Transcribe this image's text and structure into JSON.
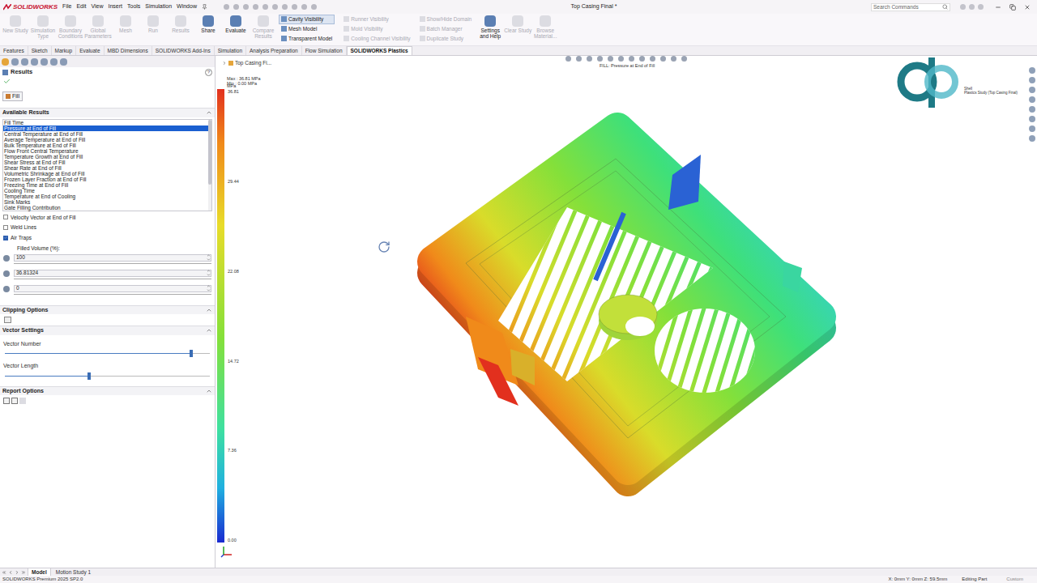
{
  "app": {
    "logo": "SOLIDWORKS",
    "menu": [
      "File",
      "Edit",
      "View",
      "Insert",
      "Tools",
      "Simulation",
      "Window"
    ],
    "title": "Top Casing Final *",
    "search": {
      "placeholder": "Search Commands"
    }
  },
  "ribbon": {
    "large_buttons": [
      {
        "label": "New Study",
        "disabled": true
      },
      {
        "label": "Simulation Type",
        "disabled": true
      },
      {
        "label": "Boundary Conditions",
        "disabled": true
      },
      {
        "label": "Global Parameters",
        "disabled": true
      },
      {
        "label": "Mesh",
        "disabled": true
      },
      {
        "label": "Run",
        "disabled": true
      },
      {
        "label": "Results",
        "disabled": true
      },
      {
        "label": "Share",
        "disabled": false
      },
      {
        "label": "Evaluate",
        "disabled": false
      },
      {
        "label": "Compare Results",
        "disabled": true
      }
    ],
    "toggles": [
      {
        "label": "Cavity Visibility",
        "selected": true,
        "disabled": false
      },
      {
        "label": "Mesh Model",
        "selected": false,
        "disabled": false
      },
      {
        "label": "Transparent Model",
        "selected": false,
        "disabled": false
      },
      {
        "label": "Runner Visibility",
        "selected": false,
        "disabled": true
      },
      {
        "label": "Mold Visibility",
        "selected": false,
        "disabled": true
      },
      {
        "label": "Cooling Channel Visibility",
        "selected": false,
        "disabled": true
      }
    ],
    "more_buttons": [
      {
        "label": "Show/Hide Domain",
        "kind": "small",
        "disabled": true
      },
      {
        "label": "Batch Manager",
        "kind": "small",
        "disabled": true
      },
      {
        "label": "Duplicate Study",
        "kind": "small",
        "disabled": true
      },
      {
        "label": "Settings and Help",
        "kind": "large",
        "disabled": false
      },
      {
        "label": "Clear Study",
        "kind": "large",
        "disabled": true
      },
      {
        "label": "Browse Material...",
        "kind": "large",
        "disabled": true
      }
    ]
  },
  "command_tabs": [
    {
      "label": "Features",
      "selected": false
    },
    {
      "label": "Sketch",
      "selected": false
    },
    {
      "label": "Markup",
      "selected": false
    },
    {
      "label": "Evaluate",
      "selected": false
    },
    {
      "label": "MBD Dimensions",
      "selected": false
    },
    {
      "label": "SOLIDWORKS Add-Ins",
      "selected": false
    },
    {
      "label": "Simulation",
      "selected": false
    },
    {
      "label": "Analysis Preparation",
      "selected": false
    },
    {
      "label": "Flow Simulation",
      "selected": false
    },
    {
      "label": "SOLIDWORKS Plastics",
      "selected": true
    }
  ],
  "results_panel": {
    "title": "Results",
    "help": "?",
    "result_tab": "Fill",
    "available_results": {
      "title": "Available Results",
      "items": [
        {
          "label": "Fill Time",
          "selected": false
        },
        {
          "label": "Pressure at End of Fill",
          "selected": true
        },
        {
          "label": "Central Temperature at End of Fill",
          "selected": false
        },
        {
          "label": "Average Temperature at End of Fill",
          "selected": false
        },
        {
          "label": "Bulk Temperature at End of Fill",
          "selected": false
        },
        {
          "label": "Flow Front Central Temperature",
          "selected": false
        },
        {
          "label": "Temperature Growth at End of Fill",
          "selected": false
        },
        {
          "label": "Shear Stress at End of Fill",
          "selected": false
        },
        {
          "label": "Shear Rate at End of Fill",
          "selected": false
        },
        {
          "label": "Volumetric Shrinkage at End of Fill",
          "selected": false
        },
        {
          "label": "Frozen Layer Fraction at End of Fill",
          "selected": false
        },
        {
          "label": "Freezing Time at End of Fill",
          "selected": false
        },
        {
          "label": "Cooling Time",
          "selected": false
        },
        {
          "label": "Temperature at End of Cooling",
          "selected": false
        },
        {
          "label": "Sink Marks",
          "selected": false
        },
        {
          "label": "Gate Filling Contribution",
          "selected": false
        }
      ]
    },
    "options": [
      {
        "label": "Velocity Vector at End of Fill",
        "checked": false
      },
      {
        "label": "Weld Lines",
        "checked": false
      },
      {
        "label": "Air Traps",
        "checked": true
      }
    ],
    "filled_volume": {
      "label": "Filled Volume (%):",
      "fields": [
        {
          "value": "100"
        },
        {
          "value": "36.81324"
        },
        {
          "value": "0"
        }
      ]
    },
    "clipping_options": {
      "title": "Clipping Options"
    },
    "vector_settings": {
      "title": "Vector Settings",
      "sliders": [
        {
          "label": "Vector Number",
          "level": 0.91
        },
        {
          "label": "Vector Length",
          "level": 0.41
        }
      ]
    },
    "report_options": {
      "title": "Report Options"
    }
  },
  "viewport": {
    "tree_root": "Top Casing Fi...",
    "plot_title": "FILL: Pressure at End of Fill",
    "max": "Max : 36.81 MPa",
    "min": "Min : 0.00 MPa",
    "legend": {
      "unit": "MPa",
      "ticks": [
        "36.81",
        "29.44",
        "22.08",
        "14.72",
        "7.36",
        "0.00"
      ]
    },
    "watermark": [
      "Shell",
      "Plastics Study (Top Casing Final)"
    ]
  },
  "bottom_tabs": [
    {
      "label": "Model",
      "selected": true
    },
    {
      "label": "Motion Study 1",
      "selected": false
    }
  ],
  "status_bar": {
    "product": "SOLIDWORKS Premium 2025 SP2.0",
    "coordinates": "X: 0mm Y: 0mm Z: 59.5mm",
    "mode": "Editing Part",
    "units": "Custom"
  }
}
